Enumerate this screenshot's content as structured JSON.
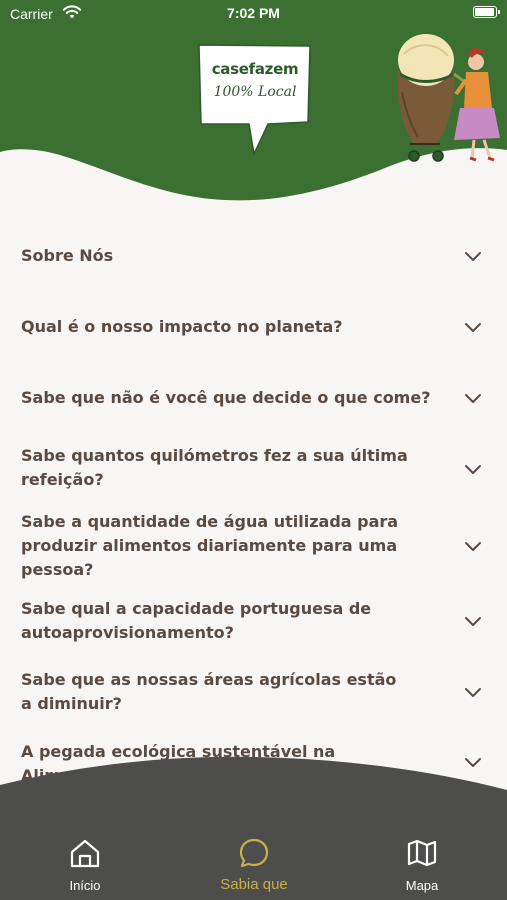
{
  "status_bar": {
    "carrier": "Carrier",
    "time": "7:02 PM",
    "battery_level": 1.0
  },
  "header": {
    "logo_title": "casefazem",
    "logo_subtitle": "100% Local",
    "illustration": "woman-pushing-cart-icon"
  },
  "faq": {
    "items": [
      {
        "question": "Sobre Nós"
      },
      {
        "question": "Qual é o nosso impacto no planeta?"
      },
      {
        "question": "Sabe que não é você que decide o que come?"
      },
      {
        "question": "Sabe quantos quilómetros fez a sua última refeição?"
      },
      {
        "question": "Sabe a quantidade de água utilizada para produzir alimentos diariamente para uma pessoa?"
      },
      {
        "question": "Sabe qual a capacidade portuguesa de autoaprovisionamento?"
      },
      {
        "question": "Sabe que as nossas áreas agrícolas estão a diminuir?"
      },
      {
        "question": "A pegada ecológica sustentável na Alimentação"
      }
    ]
  },
  "tab_bar": {
    "tabs": [
      {
        "label": "Início",
        "icon": "home-icon",
        "active": false
      },
      {
        "label": "Sabia que",
        "icon": "speech-bubble-icon",
        "active": true
      },
      {
        "label": "Mapa",
        "icon": "map-icon",
        "active": false
      }
    ]
  },
  "colors": {
    "header_green": "#3c6f32",
    "text_brown": "#5a4a41",
    "tabbar_gray": "#4d4d4c",
    "active_gold": "#c9b04a",
    "background": "#f7f6f4"
  }
}
